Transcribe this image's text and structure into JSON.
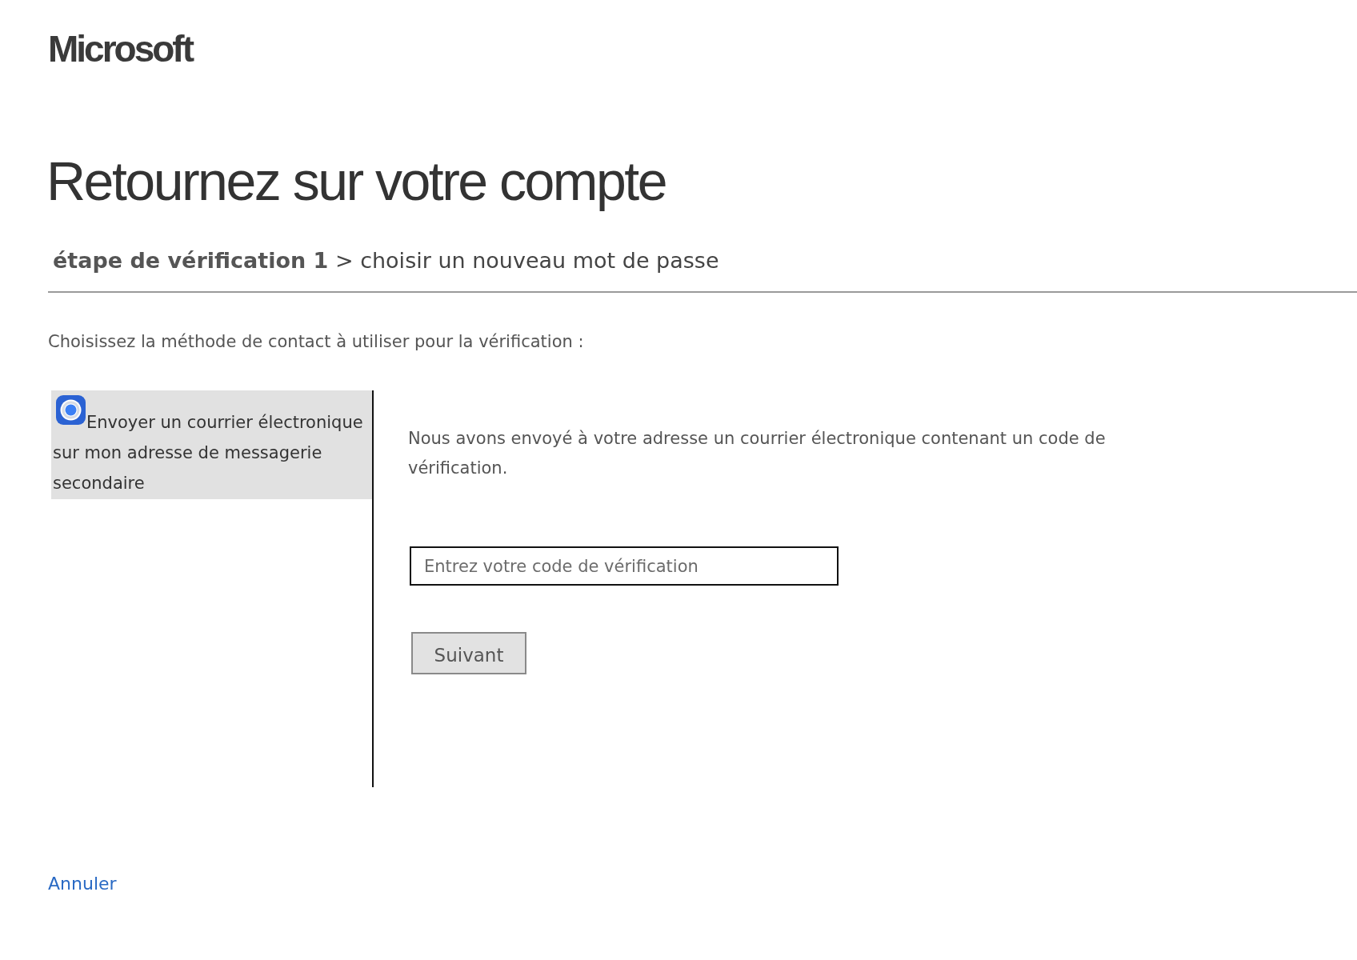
{
  "logo": {
    "text": "Microsoft"
  },
  "title": "Retournez sur votre compte",
  "step_indicator": "**étape de vérification 1** > choisir un nouveau mot de passe",
  "prompt": "Choisissez la méthode de contact à utiliser pour la vérification :",
  "contact_methods": [
    {
      "label": "Envoyer un courrier électronique sur mon adresse de messagerie secondaire",
      "selected": true
    }
  ],
  "verification": {
    "message": "Nous avons envoyé à votre adresse un courrier électronique contenant un code de vérification.",
    "code_field": {
      "placeholder": "Entrez votre code de vérification"
    },
    "submit_button": "Suivant"
  },
  "cancel_link": "Annuler"
}
